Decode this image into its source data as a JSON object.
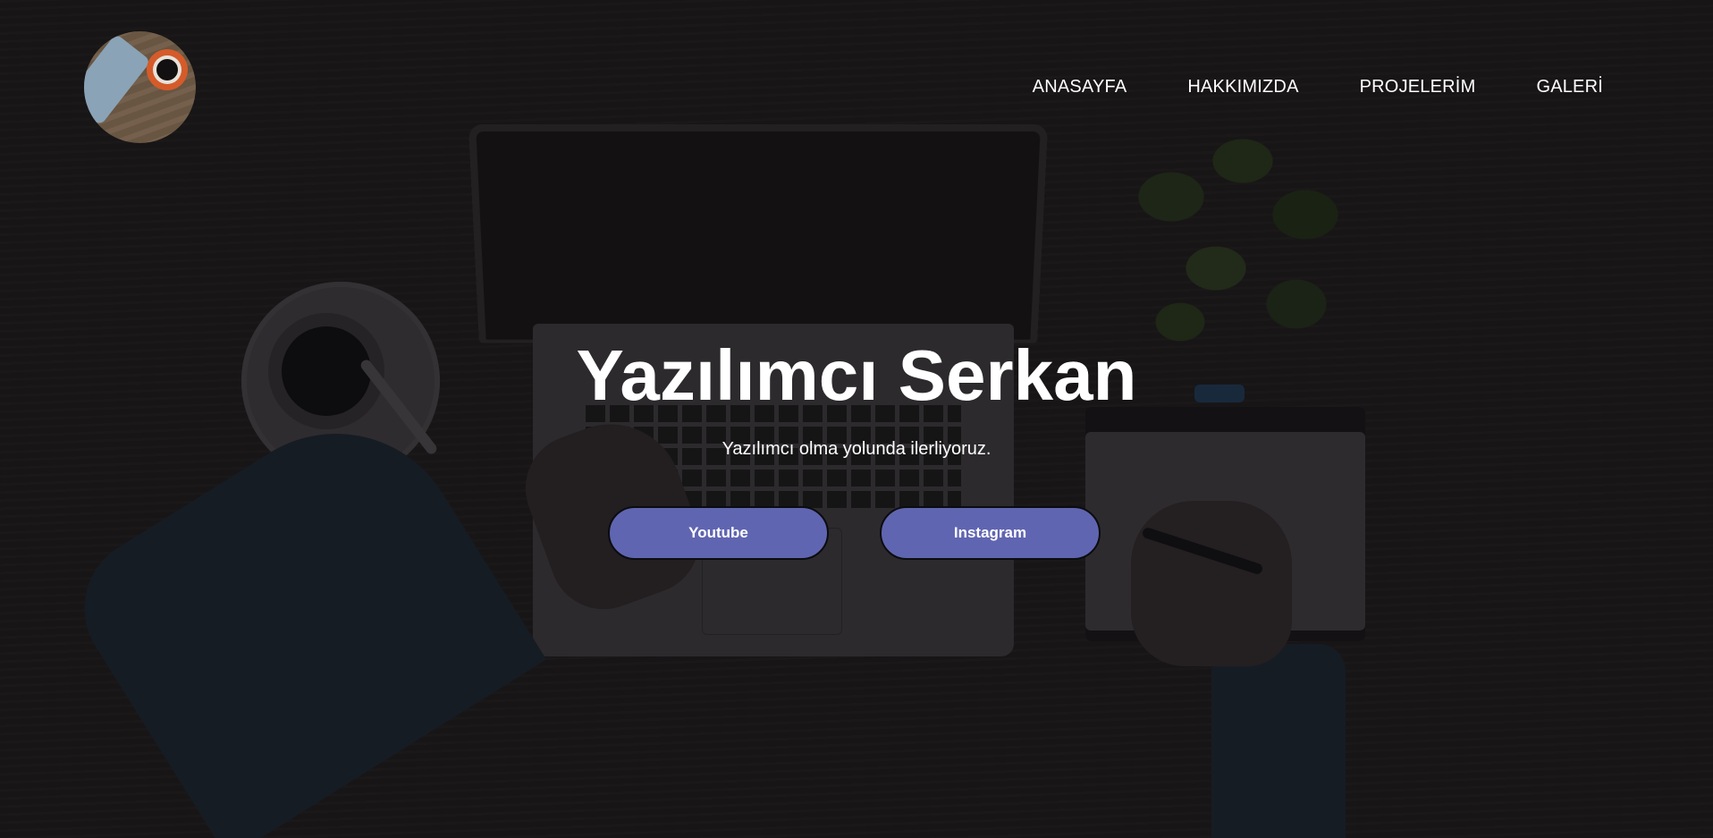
{
  "header": {
    "logo_icon": "coffee-phone-logo",
    "nav": [
      {
        "label": "ANASAYFA"
      },
      {
        "label": "HAKKIMIZDA"
      },
      {
        "label": "PROJELERİM"
      },
      {
        "label": "GALERİ"
      }
    ]
  },
  "hero": {
    "title": "Yazılımcı Serkan",
    "subtitle": "Yazılımcı olma yolunda ilerliyoruz.",
    "buttons": [
      {
        "label": "Youtube"
      },
      {
        "label": "Instagram"
      }
    ]
  },
  "colors": {
    "background": "#1b1819",
    "button": "#6065b1",
    "text": "#ffffff"
  }
}
